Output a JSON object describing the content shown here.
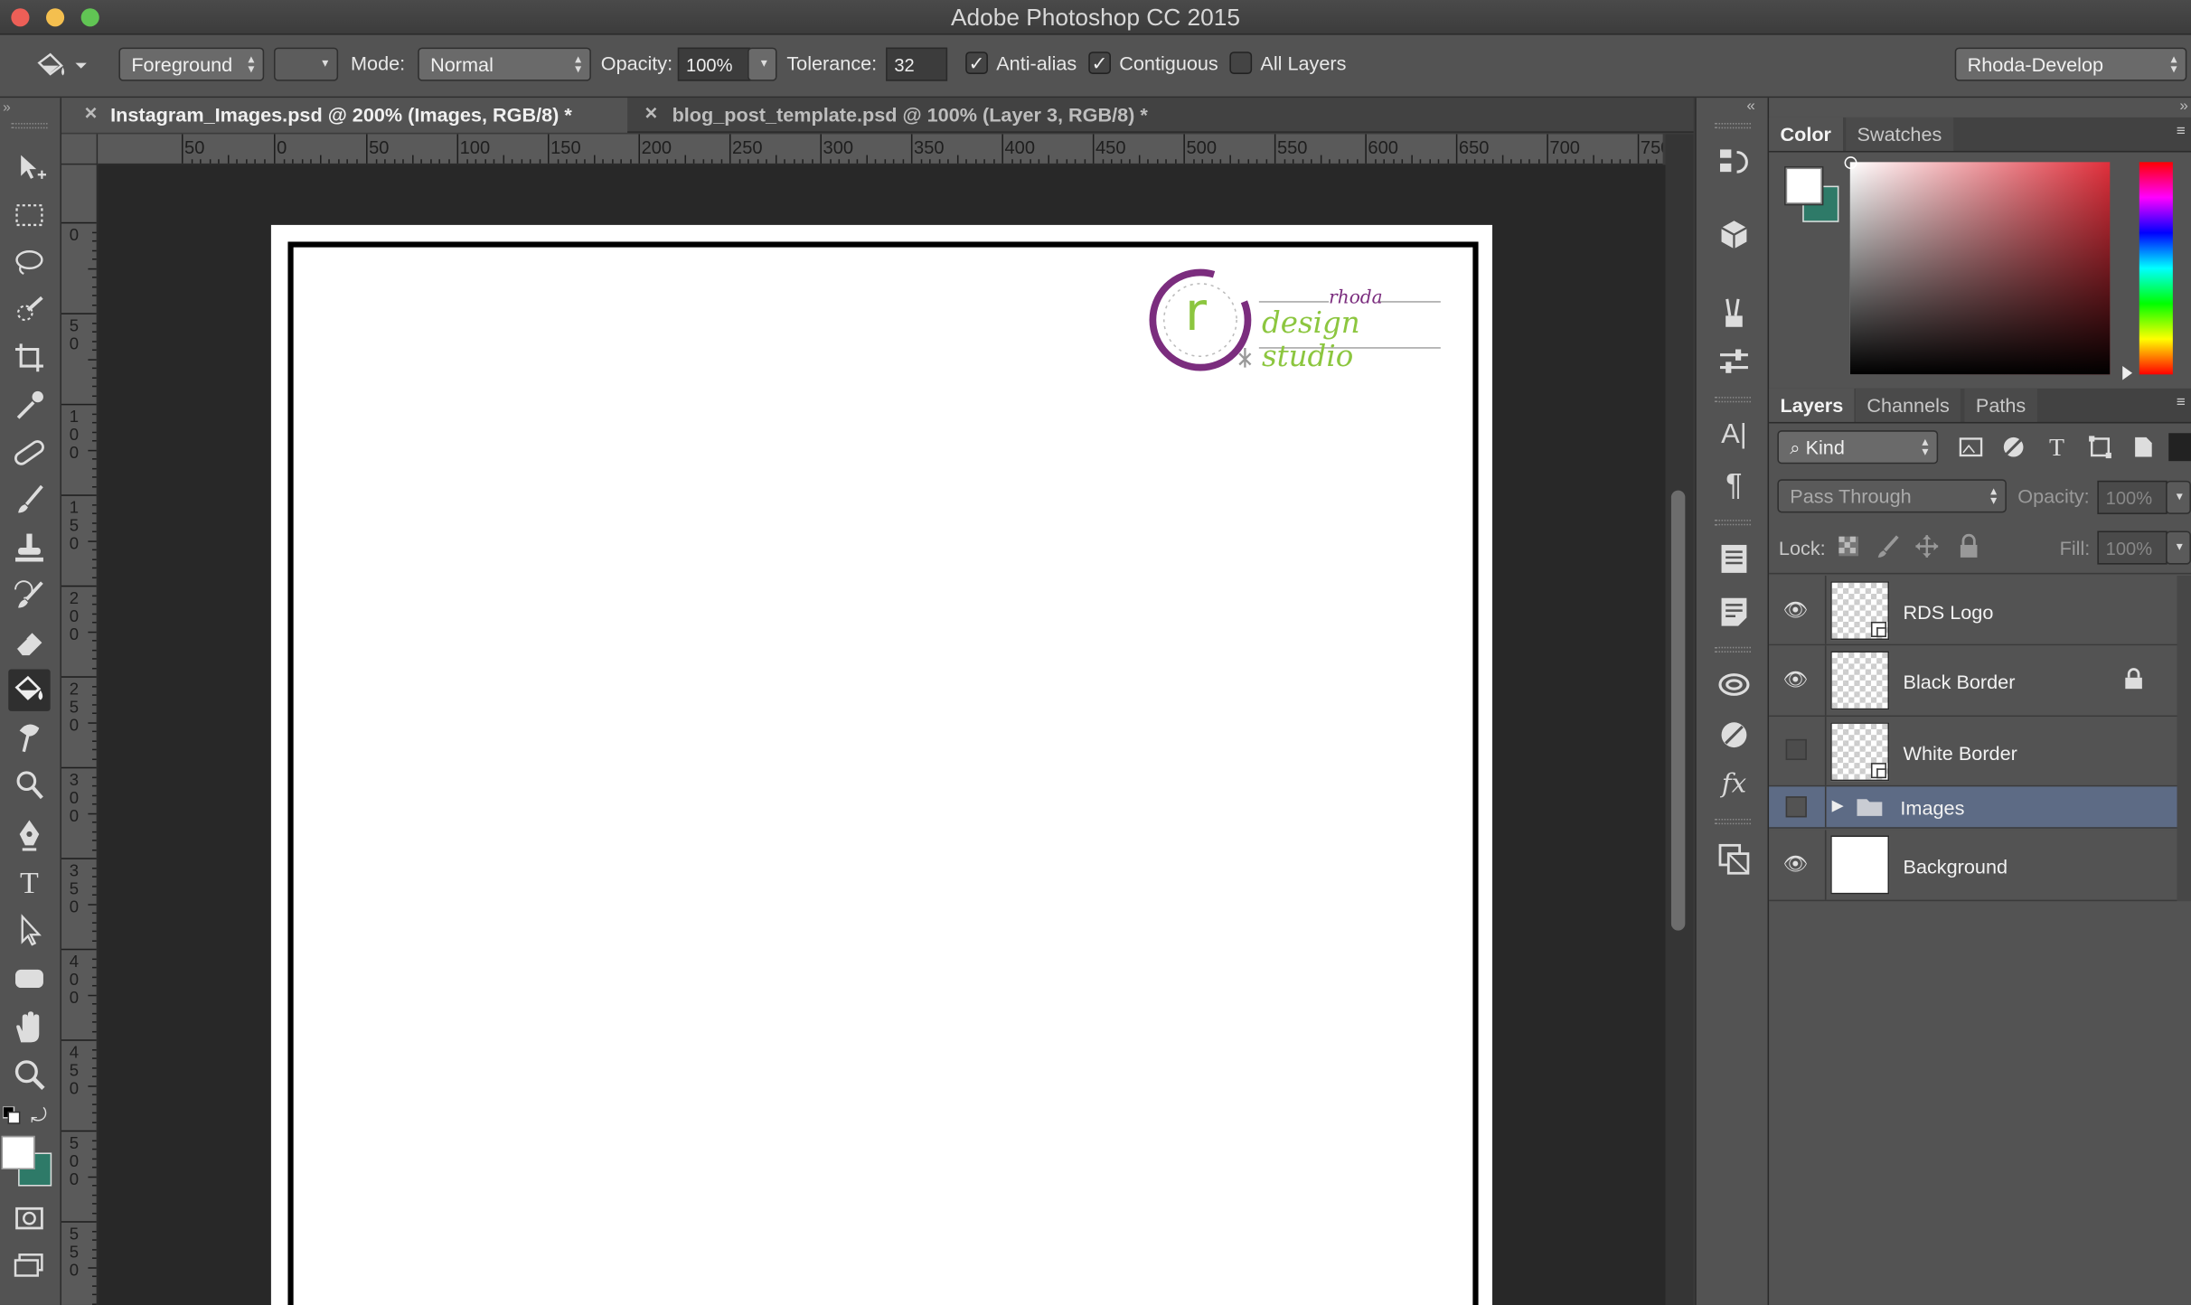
{
  "window": {
    "title": "Adobe Photoshop CC 2015",
    "traffic_colors": [
      "#ec5f57",
      "#f4bf4f",
      "#61c554"
    ]
  },
  "options_bar": {
    "fill_source": "Foreground",
    "mode_label": "Mode:",
    "mode_value": "Normal",
    "opacity_label": "Opacity:",
    "opacity_value": "100%",
    "tolerance_label": "Tolerance:",
    "tolerance_value": "32",
    "anti_alias_label": "Anti-alias",
    "anti_alias_checked": true,
    "contiguous_label": "Contiguous",
    "contiguous_checked": true,
    "all_layers_label": "All Layers",
    "all_layers_checked": false,
    "workspace": "Rhoda-Develop"
  },
  "tabs": [
    {
      "label": "Instagram_Images.psd @ 200% (Images, RGB/8) *",
      "active": true
    },
    {
      "label": "blog_post_template.psd @ 100% (Layer 3, RGB/8) *",
      "active": false
    }
  ],
  "rulers": {
    "horizontal": [
      "100",
      "50",
      "0",
      "50",
      "100",
      "150",
      "200",
      "250",
      "300",
      "350",
      "400",
      "450",
      "500",
      "550",
      "600",
      "650",
      "700",
      "750"
    ],
    "vertical": [
      "0",
      "50",
      "100",
      "150",
      "200",
      "250",
      "300",
      "350",
      "400",
      "450",
      "500",
      "550"
    ]
  },
  "logo": {
    "letter": "r",
    "small_text": "rhoda",
    "main_text": "design studio",
    "purple": "#7b2d7e",
    "green": "#8cc63f"
  },
  "color_panel": {
    "tabs": [
      "Color",
      "Swatches"
    ],
    "foreground": "#ffffff",
    "background": "#2e7a68",
    "hue_field": "#e02f3b"
  },
  "layers_panel": {
    "tabs": [
      "Layers",
      "Channels",
      "Paths"
    ],
    "filter_kind": "Kind",
    "blend_mode": "Pass Through",
    "opacity_label": "Opacity:",
    "opacity_value": "100%",
    "lock_label": "Lock:",
    "fill_label": "Fill:",
    "fill_value": "100%",
    "layers": [
      {
        "name": "RDS Logo",
        "visible": true,
        "thumb": "transparent",
        "smart": true,
        "locked": false
      },
      {
        "name": "Black Border",
        "visible": true,
        "thumb": "transparent",
        "smart": false,
        "locked": true
      },
      {
        "name": "White Border",
        "visible": false,
        "thumb": "transparent",
        "smart": true,
        "locked": false
      },
      {
        "name": "Images",
        "visible": false,
        "thumb": "folder",
        "selected": true
      },
      {
        "name": "Background",
        "visible": true,
        "thumb": "white",
        "smart": false,
        "locked": false
      }
    ]
  },
  "toolbar": {
    "tools": [
      "move-tool",
      "marquee-tool",
      "lasso-tool",
      "quick-select-tool",
      "crop-tool",
      "eyedropper-tool",
      "healing-brush-tool",
      "brush-tool",
      "clone-stamp-tool",
      "history-brush-tool",
      "eraser-tool",
      "paint-bucket-tool",
      "smudge-tool",
      "dodge-tool",
      "pen-tool",
      "type-tool",
      "path-selection-tool",
      "shape-tool",
      "hand-tool",
      "zoom-tool"
    ],
    "active_tool": "paint-bucket-tool"
  }
}
